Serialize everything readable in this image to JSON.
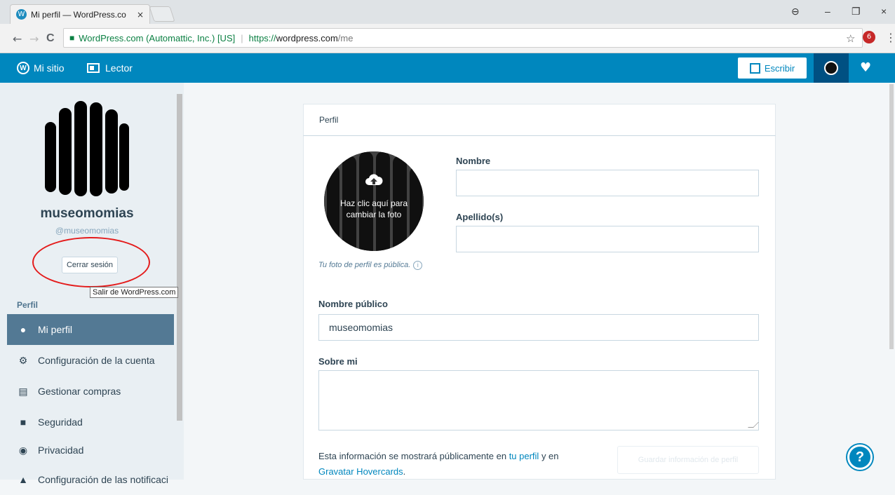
{
  "browser": {
    "tab_title": "Mi perfil — WordPress.co",
    "tab_close": "×",
    "favicon": "W",
    "controls": {
      "minimize": "–",
      "maximize": "❐",
      "close": "×",
      "profile": "⊖"
    },
    "nav": {
      "back": "←",
      "forward": "→",
      "reload": "C"
    },
    "secure_label": "WordPress.com (Automattic, Inc.) [US]",
    "url_scheme": "https://",
    "url_host": "wordpress.com",
    "url_path": "/me",
    "star": "☆",
    "menu": "⋮",
    "ext_badge": "6"
  },
  "masterbar": {
    "my_site": "Mi sitio",
    "reader": "Lector",
    "write": "Escribir",
    "brand_color": "#0087be"
  },
  "sidebar": {
    "username": "museomomias",
    "handle": "@museomomias",
    "logout": "Cerrar sesión",
    "tooltip": "Salir de WordPress.com",
    "section": "Perfil",
    "items": [
      {
        "label": "Mi perfil",
        "icon": "user-icon",
        "active": true
      },
      {
        "label": "Configuración de la cuenta",
        "icon": "cog-icon"
      },
      {
        "label": "Gestionar compras",
        "icon": "credit-card-icon"
      },
      {
        "label": "Seguridad",
        "icon": "lock-icon"
      },
      {
        "label": "Privacidad",
        "icon": "eye-icon"
      },
      {
        "label": "Configuración de las notificaci",
        "icon": "bell-icon"
      }
    ]
  },
  "profile": {
    "card_title": "Perfil",
    "photo_overlay": "Haz clic aquí para cambiar la foto",
    "photo_note": "Tu foto de perfil es pública.",
    "first_name_label": "Nombre",
    "first_name_value": "",
    "last_name_label": "Apellido(s)",
    "last_name_value": "",
    "display_name_label": "Nombre público",
    "display_name_value": "museomomias",
    "about_label": "Sobre mi",
    "about_value": "",
    "footnote_pre": "Esta información se mostrará públicamente en ",
    "footnote_link1": "tu perfil",
    "footnote_mid": " y en ",
    "footnote_link2": "Gravatar Hovercards",
    "footnote_end": ".",
    "save": "Guardar información de perfil",
    "help": "?"
  }
}
